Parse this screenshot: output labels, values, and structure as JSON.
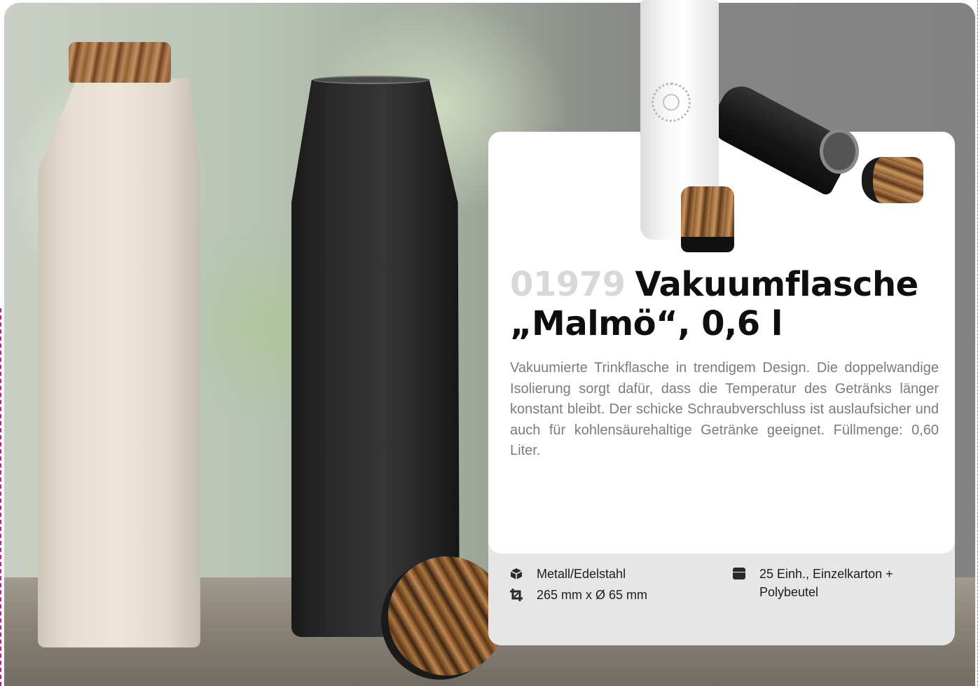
{
  "product": {
    "article_number": "01979",
    "title_line1": "Vakuumflasche",
    "title_line2": "„Malmö“, 0,6 l",
    "description": "Vakuumierte Trinkflasche in trendigem Design. Die doppelwandige Isolierung sorgt dafür, dass die Temperatur des Getränks länger konstant bleibt. Der schicke Schraubverschluss ist auslaufsicher und auch für kohlensäurehaltige Getränke geeignet. Füllmenge: 0,60 Liter."
  },
  "specs": {
    "material": {
      "icon": "cube-icon",
      "text": "Metall/Edelstahl"
    },
    "dimensions": {
      "icon": "crop-icon",
      "text": "265 mm x Ø 65 mm"
    },
    "packaging": {
      "icon": "box-icon",
      "text": "25 Einh., Einzelkarton + Polybeutel"
    }
  },
  "colors": {
    "card_background": "#ffffff",
    "spec_background": "#e6e6e6",
    "article_number": "#d8d8d8",
    "title": "#0e0e0e",
    "description": "#7b7b7b",
    "page_background": "#858585"
  }
}
